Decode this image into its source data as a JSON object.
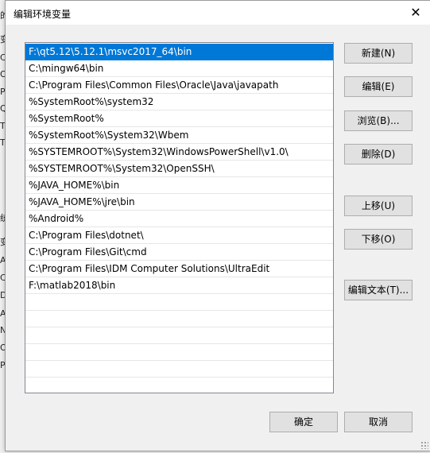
{
  "background": {
    "fragments": [
      "的",
      "变",
      "CL",
      "O",
      "Pa",
      "Q",
      "TE",
      "TN",
      "统",
      "变",
      "Ar",
      "Co",
      "Dr",
      "A",
      "N",
      "O",
      "Pa"
    ]
  },
  "dialog": {
    "title": "编辑环境变量",
    "close_glyph": "✕"
  },
  "list": {
    "items": [
      "F:\\qt5.12\\5.12.1\\msvc2017_64\\bin",
      "C:\\mingw64\\bin",
      "C:\\Program Files\\Common Files\\Oracle\\Java\\javapath",
      "%SystemRoot%\\system32",
      "%SystemRoot%",
      "%SystemRoot%\\System32\\Wbem",
      "%SYSTEMROOT%\\System32\\WindowsPowerShell\\v1.0\\",
      "%SYSTEMROOT%\\System32\\OpenSSH\\",
      "%JAVA_HOME%\\bin",
      "%JAVA_HOME%\\jre\\bin",
      "%Android%",
      "C:\\Program Files\\dotnet\\",
      "C:\\Program Files\\Git\\cmd",
      "C:\\Program Files\\IDM Computer Solutions\\UltraEdit",
      "F:\\matlab2018\\bin",
      "",
      "",
      "",
      "",
      "",
      ""
    ],
    "selected_index": 0
  },
  "buttons": {
    "new": "新建(N)",
    "edit": "编辑(E)",
    "browse": "浏览(B)...",
    "delete": "删除(D)",
    "move_up": "上移(U)",
    "move_down": "下移(O)",
    "edit_text": "编辑文本(T)...",
    "ok": "确定",
    "cancel": "取消"
  },
  "colors": {
    "selection": "#0078d7",
    "button_face": "#e1e1e1",
    "dialog_bg": "#f0f0f0"
  }
}
